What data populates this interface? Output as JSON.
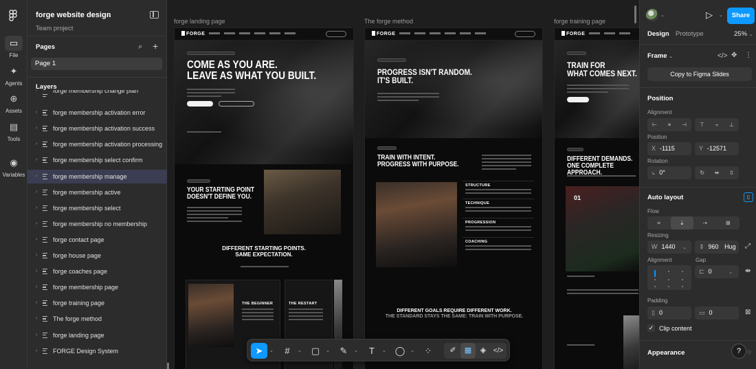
{
  "rail": {
    "items": [
      {
        "label": "File",
        "icon": "file-icon"
      },
      {
        "label": "Agents",
        "icon": "agents-icon"
      },
      {
        "label": "Assets",
        "icon": "assets-icon"
      },
      {
        "label": "Tools",
        "icon": "tools-icon"
      },
      {
        "label": "Variables",
        "icon": "variables-icon"
      }
    ]
  },
  "project": {
    "title": "forge website design",
    "subtitle": "Team project"
  },
  "pages": {
    "title": "Pages",
    "items": [
      "Page 1"
    ]
  },
  "layers": {
    "title": "Layers",
    "items": [
      "forge membership change plan",
      "forge membership activation error",
      "forge membership activation success",
      "forge membership activation processing",
      "forge membership select confirm",
      "forge membership manage",
      "forge membership active",
      "forge membership select",
      "forge membership no membership",
      "forge contact page",
      "forge house page",
      "forge coaches page",
      "forge membership page",
      "forge training page",
      "The forge method",
      "forge landing page",
      "FORGE Design System"
    ],
    "selected_index": 5
  },
  "canvas": {
    "frames": [
      {
        "label": "forge landing page",
        "brand": "FORGE",
        "hero_line1": "COME AS YOU ARE.",
        "hero_line2": "LEAVE AS WHAT YOU BUILT.",
        "section_line1": "YOUR STARTING POINT",
        "section_line2": "DOESN'T DEFINE YOU.",
        "sub_line1": "DIFFERENT STARTING POINTS.",
        "sub_line2": "SAME EXPECTATION.",
        "card1": "THE BEGINNER",
        "card2": "THE RESTART"
      },
      {
        "label": "The forge method",
        "brand": "FORGE",
        "hero_line1": "PROGRESS ISN'T RANDOM.",
        "hero_line2": "IT'S BUILT.",
        "section_line1": "TRAIN WITH INTENT.",
        "section_line2": "PROGRESS WITH PURPOSE.",
        "steps": [
          "STRUCTURE",
          "TECHNIQUE",
          "PROGRESSION",
          "COACHING"
        ],
        "sub_line1": "DIFFERENT GOALS REQUIRE DIFFERENT WORK.",
        "sub_line2": "THE STANDARD STAYS THE SAME: TRAIN WITH PURPOSE."
      },
      {
        "label": "forge training page",
        "brand": "FORGE",
        "hero_line1": "TRAIN FOR",
        "hero_line2": "WHAT COMES NEXT.",
        "section_line1": "DIFFERENT DEMANDS.",
        "section_line2": "ONE COMPLETE APPROACH.",
        "number": "01"
      }
    ]
  },
  "toolbar": {
    "tools": [
      "move-tool",
      "frame-tool",
      "shape-tool",
      "pen-tool",
      "text-tool",
      "comment-tool",
      "actions-tool",
      "draw-mode",
      "design-mode",
      "prototype-mode",
      "dev-mode"
    ]
  },
  "right": {
    "share_label": "Share",
    "tabs": [
      "Design",
      "Prototype"
    ],
    "zoom": "25%",
    "frame_label": "Frame",
    "copy_slides": "Copy to Figma Slides",
    "position_title": "Position",
    "alignment_label": "Alignment",
    "position_label": "Position",
    "x_key": "X",
    "x_value": "-1115",
    "y_key": "Y",
    "y_value": "-12571",
    "rotation_label": "Rotation",
    "rotation_value": "0°",
    "auto_layout_title": "Auto layout",
    "flow_label": "Flow",
    "resizing_label": "Resizing",
    "w_key": "W",
    "w_value": "1440",
    "h_value": "960",
    "h_mode": "Hug",
    "alignment2_label": "Alignment",
    "gap_label": "Gap",
    "gap_value": "0",
    "padding_label": "Padding",
    "padding_h": "0",
    "padding_v": "0",
    "clip_label": "Clip content",
    "appearance_title": "Appearance",
    "help": "?"
  }
}
